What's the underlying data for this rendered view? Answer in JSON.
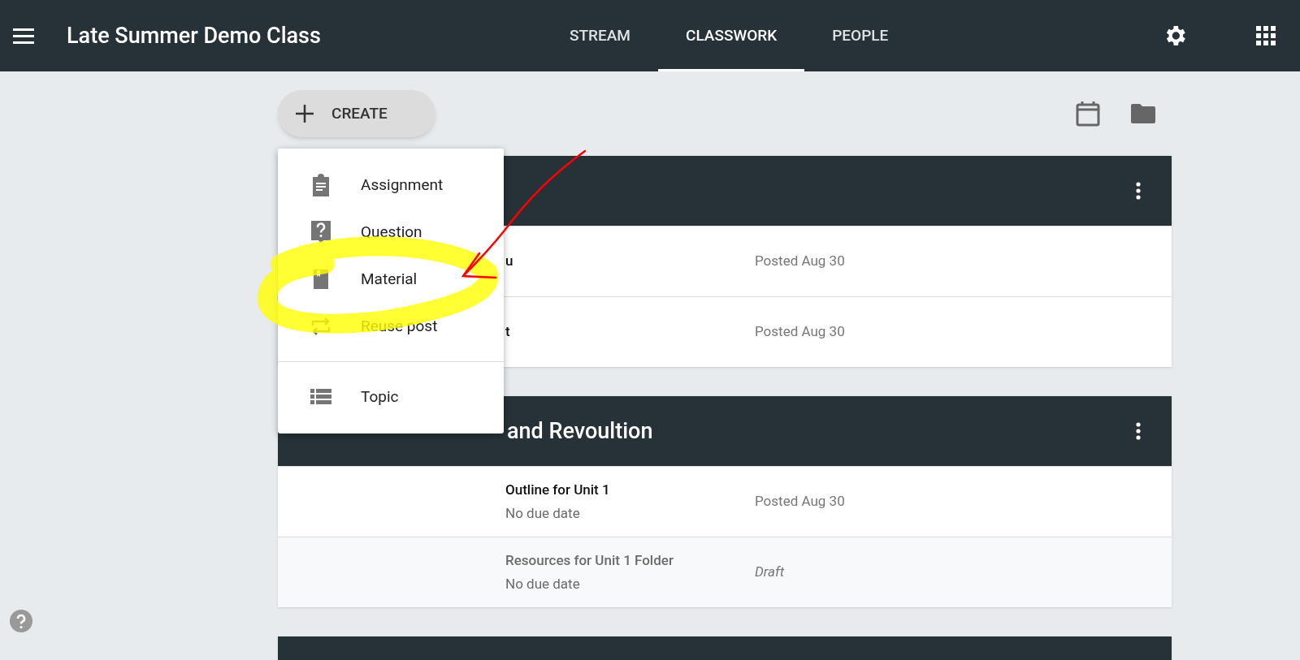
{
  "app_bar": {
    "title": "Late Summer Demo Class",
    "tabs": [
      {
        "label": "STREAM",
        "selected": false
      },
      {
        "label": "CLASSWORK",
        "selected": true
      },
      {
        "label": "PEOPLE",
        "selected": false
      }
    ]
  },
  "create_button": {
    "label": "CREATE"
  },
  "create_menu": {
    "groups": [
      [
        {
          "kind": "assignment",
          "label": "Assignment"
        },
        {
          "kind": "question",
          "label": "Question"
        },
        {
          "kind": "material",
          "label": "Material"
        },
        {
          "kind": "reuse",
          "label": "Reuse post"
        }
      ],
      [
        {
          "kind": "topic",
          "label": "Topic"
        }
      ]
    ]
  },
  "topics": [
    {
      "covered": true,
      "more_button": true,
      "items": [
        {
          "title": "u",
          "status": "Posted Aug 30",
          "draft": false
        },
        {
          "title": "t",
          "status": "Posted Aug 30",
          "draft": false
        }
      ]
    },
    {
      "covered": true,
      "more_button": true,
      "heading": "and Revoultion",
      "items": [
        {
          "title": "Outline for Unit 1",
          "subtitle": "No due date",
          "status": "Posted Aug 30",
          "draft": false
        },
        {
          "title": "Resources for Unit 1 Folder",
          "subtitle": "No due date",
          "status": "Draft",
          "draft": true
        }
      ]
    }
  ]
}
